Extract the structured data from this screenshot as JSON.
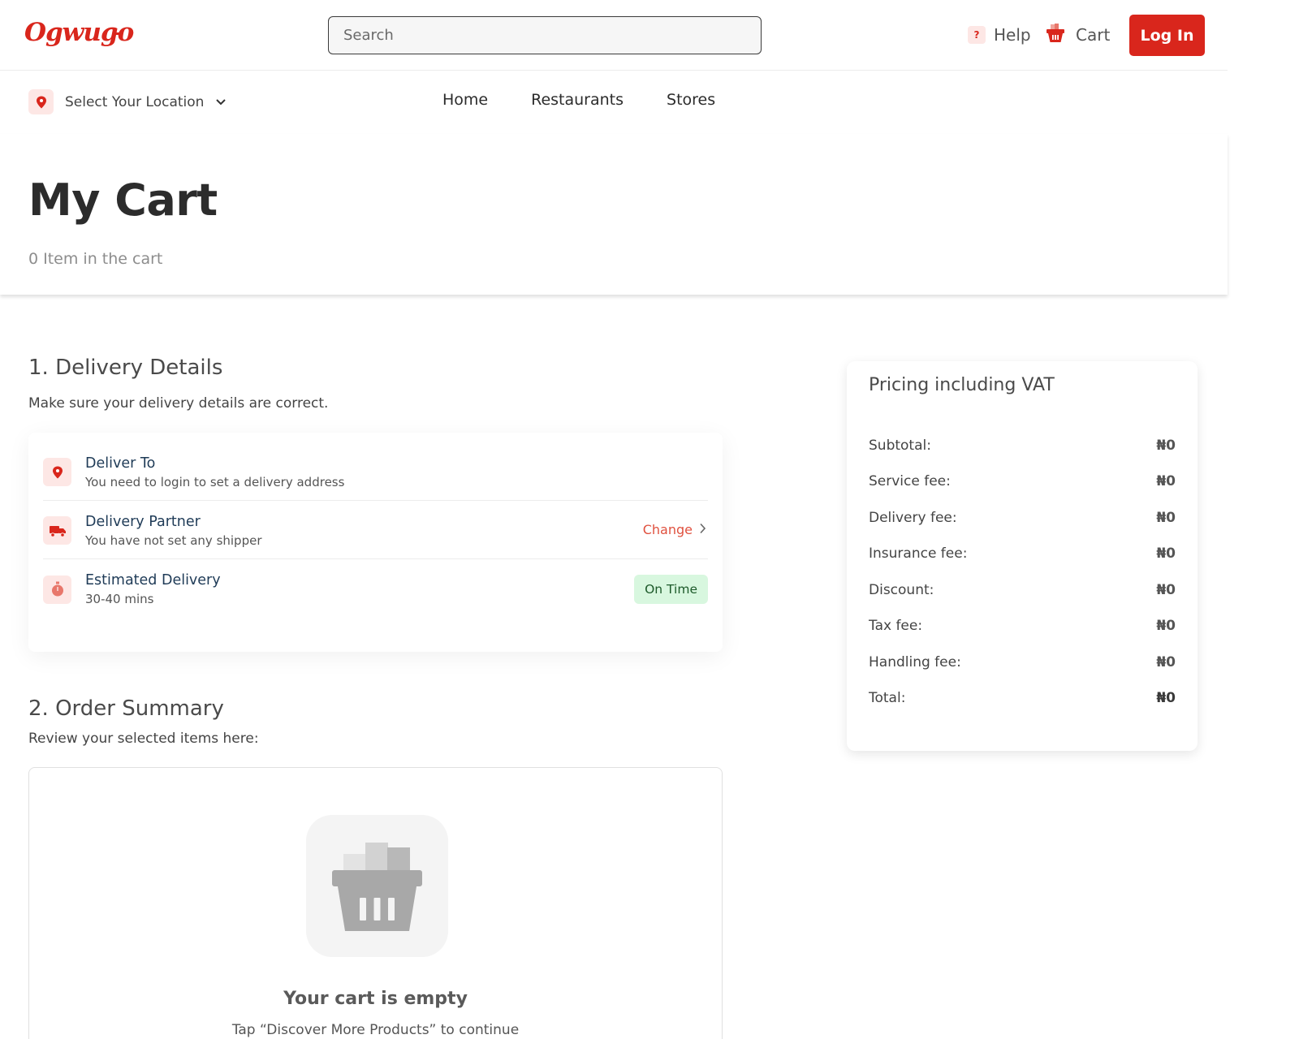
{
  "header": {
    "logo_text": "Ogwugo",
    "search_placeholder": "Search",
    "help_label": "Help",
    "cart_label": "Cart",
    "login_label": "Log In"
  },
  "subnav": {
    "location_label": "Select Your Location",
    "links": [
      "Home",
      "Restaurants",
      "Stores"
    ]
  },
  "hero": {
    "title": "My Cart",
    "item_count": "0 Item in the cart"
  },
  "delivery": {
    "title": "1. Delivery Details",
    "subtitle": "Make sure your delivery details are correct.",
    "rows": [
      {
        "title": "Deliver To",
        "subtitle": "You need to login to set a delivery address"
      },
      {
        "title": "Delivery Partner",
        "subtitle": "You have not set any shipper",
        "action": "Change"
      },
      {
        "title": "Estimated Delivery",
        "subtitle": "30-40 mins",
        "badge": "On Time"
      }
    ]
  },
  "order_summary": {
    "title": "2. Order Summary",
    "subtitle": "Review your selected items here:",
    "empty_title": "Your cart is empty",
    "empty_subtitle": "Tap “Discover More Products” to continue"
  },
  "pricing": {
    "title": "Pricing including VAT",
    "rows": [
      {
        "label": "Subtotal:",
        "value": "₦0"
      },
      {
        "label": "Service fee:",
        "value": "₦0"
      },
      {
        "label": "Delivery fee:",
        "value": "₦0"
      },
      {
        "label": "Insurance fee:",
        "value": "₦0"
      },
      {
        "label": "Discount:",
        "value": "₦0"
      },
      {
        "label": "Tax fee:",
        "value": "₦0"
      },
      {
        "label": "Handling fee:",
        "value": "₦0"
      },
      {
        "label": "Total:",
        "value": "₦0"
      }
    ]
  },
  "colors": {
    "brand": "#d9261c",
    "icon_bg": "#fde7e5",
    "badge_bg": "#d8f7df"
  }
}
